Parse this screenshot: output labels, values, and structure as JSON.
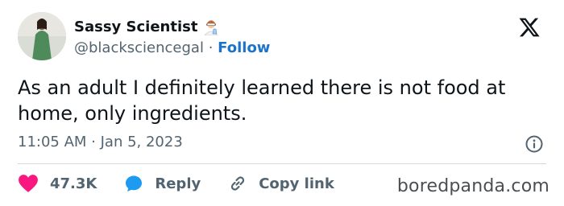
{
  "author": {
    "display_name": "Sassy Scientist",
    "handle": "@blacksciencegal",
    "separator": "·",
    "follow_label": "Follow"
  },
  "tweet": {
    "text": "As an adult I definitely learned there is not food at home, only ingredients.",
    "timestamp": "11:05 AM · Jan 5, 2023"
  },
  "actions": {
    "like_count": "47.3K",
    "reply_label": "Reply",
    "copy_link_label": "Copy link"
  },
  "watermark": "boredpanda.com",
  "colors": {
    "like": "#f91880",
    "reply": "#1d9bf0",
    "follow": "#1d73c9",
    "secondary_text": "#536471"
  },
  "icons": [
    "x-logo-icon",
    "scientist-emoji-icon",
    "info-icon",
    "heart-icon",
    "reply-bubble-icon",
    "link-icon"
  ]
}
